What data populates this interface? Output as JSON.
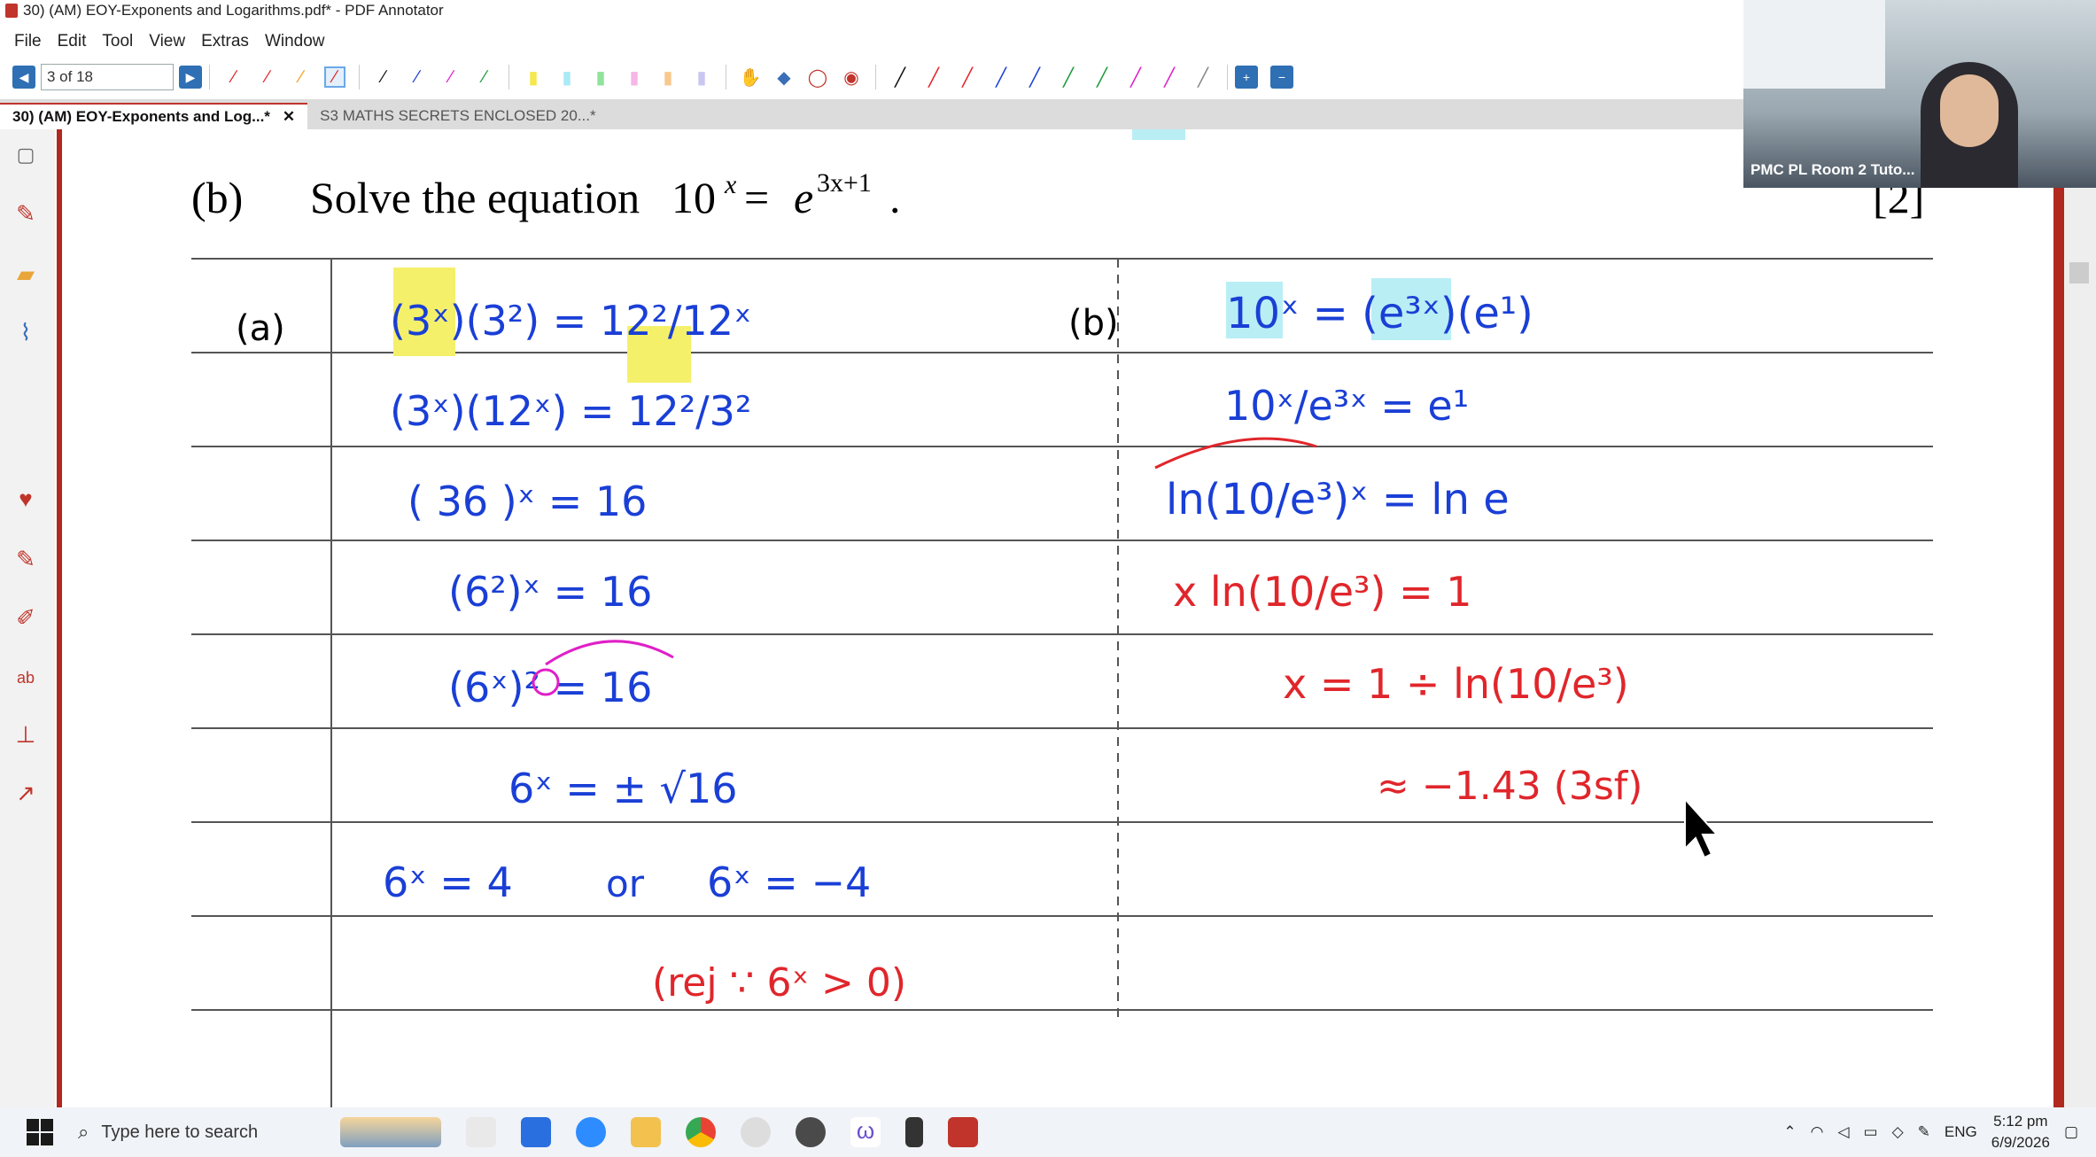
{
  "window": {
    "title": "30) (AM) EOY-Exponents and Logarithms.pdf* - PDF Annotator"
  },
  "menu": [
    "File",
    "Edit",
    "Tool",
    "View",
    "Extras",
    "Window"
  ],
  "toolbar": {
    "page_field": "3 of 18"
  },
  "tabs": [
    {
      "label": "30) (AM) EOY-Exponents and Log...*",
      "close": "✕"
    },
    {
      "label": "S3 MATHS SECRETS ENCLOSED 20...*"
    }
  ],
  "question": {
    "part": "(b)",
    "prompt": "Solve the equation",
    "marks": "[2]"
  },
  "work_a": {
    "label": "(a)",
    "lines": [
      "(3ˣ)(3²) = 12²/12ˣ",
      "(3ˣ)(12ˣ) = 12²/3²",
      "( 36 )ˣ = 16",
      "(6²)ˣ = 16",
      "(6ˣ)² = 16",
      "6ˣ = ± √16",
      "6ˣ = 4",
      "or",
      "6ˣ = −4",
      "(rej ∵ 6ˣ > 0)"
    ]
  },
  "work_b": {
    "label": "(b)",
    "lines": [
      "10ˣ = (e³ˣ)(e¹)",
      "10ˣ/e³ˣ = e¹",
      "ln(10/e³)ˣ = ln e",
      "x ln(10/e³) = 1",
      "x = 1 ÷ ln(10/e³)",
      "≈ −1.43 (3sf)"
    ]
  },
  "video": {
    "label": "PMC PL Room 2 Tuto..."
  },
  "taskbar": {
    "search_placeholder": "Type here to search",
    "lang": "ENG",
    "time": "5:12 pm",
    "date": "6/9/2026"
  },
  "colors": {
    "blue_ink": "#1a3fd6",
    "red_ink": "#e0262b",
    "magenta_ink": "#e01fc8",
    "yellow_hl": "#f5f06a",
    "cyan_hl": "#b9eef5",
    "accent": "#b0281e"
  }
}
